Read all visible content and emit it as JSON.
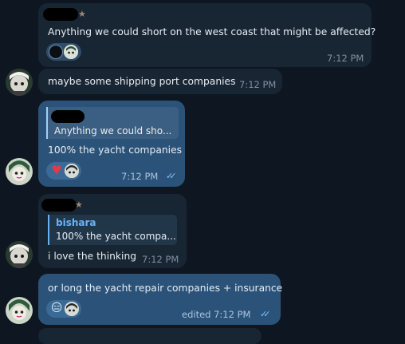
{
  "messages": [
    {
      "text": "Anything we could short on the west coast that might be affected?",
      "time": "7:12 PM"
    },
    {
      "text": "maybe some shipping port companies",
      "time": "7:12 PM"
    },
    {
      "quote_text": "Anything we could sho...",
      "text": "100% the yacht companies",
      "time": "7:12 PM",
      "reaction_emoji": "♥"
    },
    {
      "quote_name": "bishara",
      "quote_text": "100% the yacht compa...",
      "text": "i love the thinking",
      "time": "7:12 PM"
    },
    {
      "text": "or long the yacht repair companies + insurance",
      "time": "edited 7:12 PM",
      "reaction_emoji": "😑"
    }
  ],
  "icons": {
    "sender_badge": "star-icon",
    "read_status": "double-check-icon",
    "avatar": "avatar-icon"
  },
  "colors": {
    "background": "#0e1621",
    "incoming_bubble": "#182533",
    "outgoing_bubble": "#2b5278",
    "accent": "#6ab3f3"
  }
}
